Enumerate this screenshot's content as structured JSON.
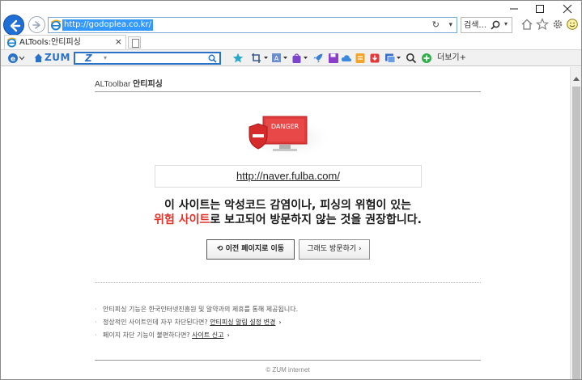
{
  "browser": {
    "address": {
      "url": "http://godoplea.co.kr/"
    },
    "search": {
      "label": "검색..."
    },
    "tab": {
      "title": "ALTools:안티피싱"
    },
    "window": {
      "minimize": "—",
      "maximize": "☐",
      "close": "✕"
    }
  },
  "toolbar": {
    "brand": "ZUM",
    "search_logo": "Z",
    "more_label": "더보기+"
  },
  "page": {
    "header": {
      "brand_prefix": "ALToolbar",
      "brand_title": "안티피싱"
    },
    "danger_label": "DANGER",
    "blocked_url": "http://naver.fulba.com/",
    "warning": {
      "line1": "이 사이트는 악성코드 감염이나, 피싱의 위험이 있는",
      "line2_red": "위험 사이트",
      "line2_rest": "로 보고되어 방문하지 않는 것을 권장합니다."
    },
    "buttons": {
      "back": "이전 페이지로 이동",
      "visit": "그래도 방문하기"
    },
    "notes": [
      {
        "text": "안티피싱 기능은 한국인터넷진흥원 및 알약과의 제휴를 통해 제공됩니다.",
        "link": ""
      },
      {
        "text": "정상적인 사이트인데 자꾸 차단된다면?",
        "link": "안티피싱 알림 설정 변경"
      },
      {
        "text": "페이지 차단 기능이 불편하다면?",
        "link": "사이트 신고"
      }
    ],
    "footer": "© ZUM internet"
  },
  "colors": {
    "accent_blue": "#1f6fd6",
    "danger_red": "#e0332a",
    "selection_blue": "#3399ff"
  }
}
